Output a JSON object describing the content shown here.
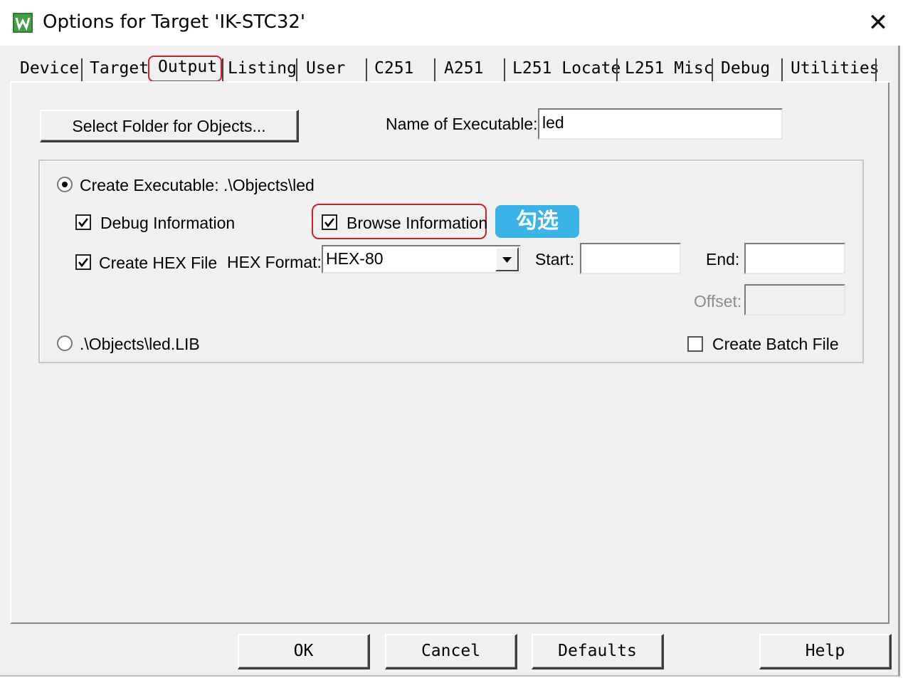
{
  "window": {
    "title": "Options for Target 'IK-STC32'",
    "close_glyph": "✕",
    "app_icon": "keil-uvision-icon"
  },
  "tabs": [
    {
      "label": "Device",
      "active": false
    },
    {
      "label": "Target",
      "active": false
    },
    {
      "label": "Output",
      "active": true
    },
    {
      "label": "Listing",
      "active": false
    },
    {
      "label": "User",
      "active": false
    },
    {
      "label": "C251",
      "active": false
    },
    {
      "label": "A251",
      "active": false
    },
    {
      "label": "L251 Locate",
      "active": false
    },
    {
      "label": "L251 Misc",
      "active": false
    },
    {
      "label": "Debug",
      "active": false
    },
    {
      "label": "Utilities",
      "active": false
    }
  ],
  "output": {
    "select_folder_label": "Select Folder for Objects...",
    "name_of_executable_label": "Name of Executable:",
    "name_of_executable_value": "led",
    "create_executable_label": "Create Executable:  .\\Objects\\led",
    "create_executable_selected": true,
    "debug_info_label": "Debug Information",
    "debug_info_checked": true,
    "browse_info_label": "Browse Information",
    "browse_info_checked": true,
    "annotation": "勾选",
    "create_hex_label": "Create HEX File",
    "create_hex_checked": true,
    "hex_format_label": "HEX Format:",
    "hex_format_value": "HEX-80",
    "start_label": "Start:",
    "start_value": "",
    "end_label": "End:",
    "end_value": "",
    "offset_label": "Offset:",
    "offset_value": "",
    "library_label": ".\\Objects\\led.LIB",
    "library_selected": false,
    "batch_file_label": "Create Batch File",
    "batch_file_checked": false
  },
  "buttons": {
    "ok": "OK",
    "cancel": "Cancel",
    "defaults": "Defaults",
    "help": "Help"
  },
  "colors": {
    "highlight_red": "#d11f2a",
    "annotation_blue": "#38b4e8",
    "dialog_bg": "#f0f0f0"
  }
}
